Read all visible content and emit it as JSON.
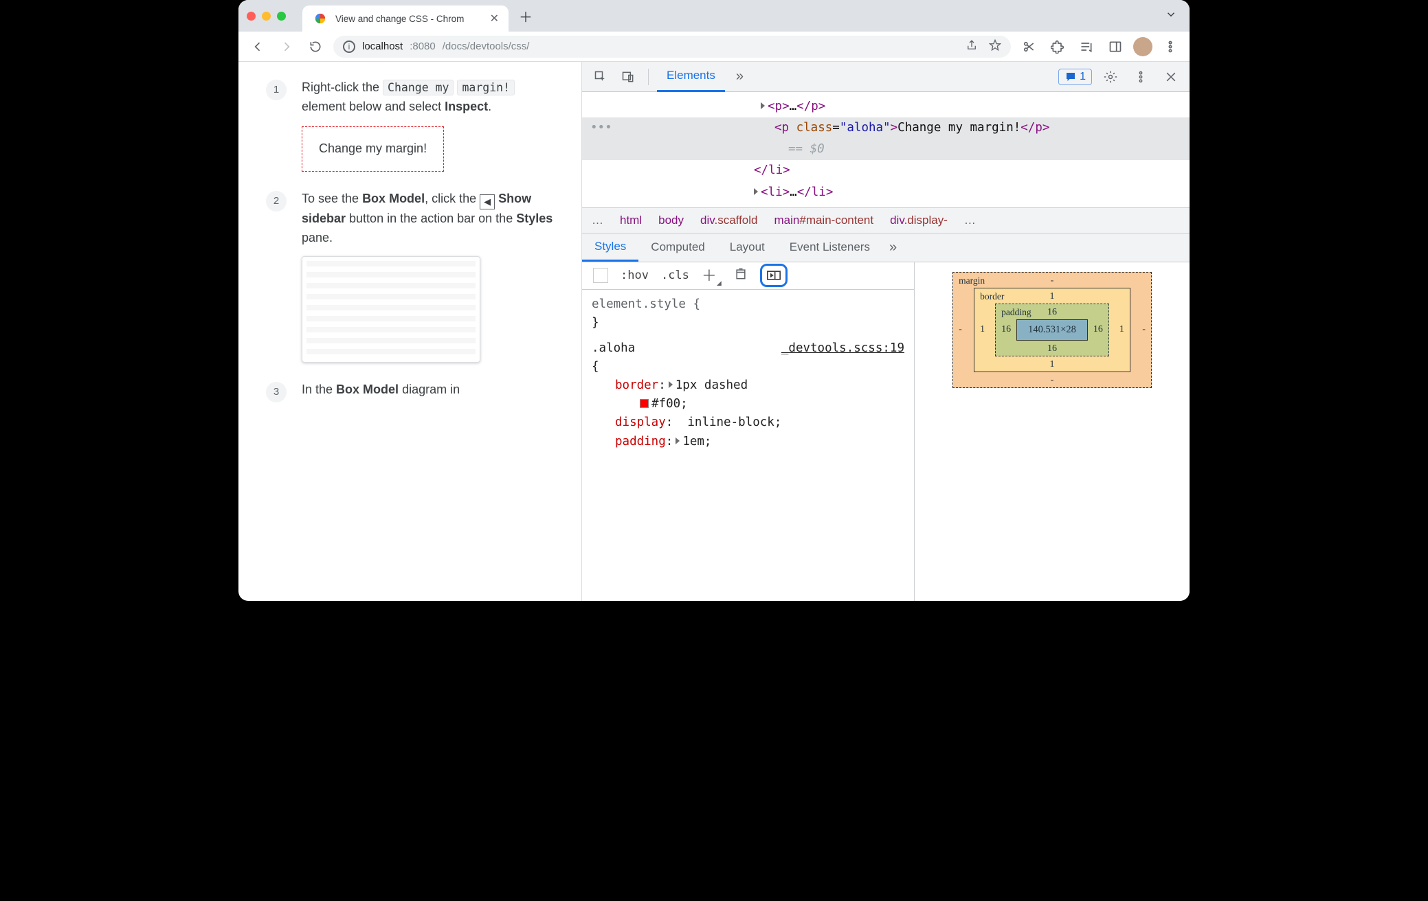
{
  "browser": {
    "tab_title": "View and change CSS - Chrom",
    "url_host": "localhost",
    "url_port": ":8080",
    "url_path": "/docs/devtools/css/"
  },
  "page": {
    "steps": [
      {
        "num": "1",
        "text_a": "Right-click the ",
        "chip_a": "Change my",
        "chip_b": "margin!",
        "text_b": " element below and select ",
        "bold_a": "Inspect",
        "text_c": ".",
        "demo": "Change my margin!"
      },
      {
        "num": "2",
        "text_a": "To see the ",
        "bold_a": "Box Model",
        "text_b": ", click the ",
        "bold_b": "Show sidebar",
        "text_c": " button in the action bar on the ",
        "bold_c": "Styles",
        "text_d": " pane."
      },
      {
        "num": "3",
        "text_a": "In the ",
        "bold_a": "Box Model",
        "text_b": " diagram in"
      }
    ]
  },
  "devtools": {
    "tabs": {
      "elements": "Elements"
    },
    "issues_count": "1",
    "dom": {
      "row1": "<p>…</p>",
      "row2_open": "<p class=\"aloha\">",
      "row2_text": "Change my margin!",
      "row2_close": "</p>",
      "row2_eq": "== $0",
      "row3": "</li>",
      "row4": "<li>…</li>"
    },
    "crumbs": [
      "…",
      "html",
      "body",
      "div",
      ".scaffold",
      "main",
      "#main-content",
      "div",
      ".display-"
    ],
    "styles_tabs": [
      "Styles",
      "Computed",
      "Layout",
      "Event Listeners"
    ],
    "actionbar": {
      "hov": ":hov",
      "cls": ".cls"
    },
    "css": {
      "element_style": "element.style {",
      "close": "}",
      "selector": ".aloha",
      "source": "_devtools.scss:19",
      "brace": "{",
      "rules": [
        {
          "prop": "border",
          "val_pre": "1px dashed",
          "val_color": "#f00",
          "has_tri": true,
          "has_swatch": true
        },
        {
          "prop": "display",
          "val_pre": "inline-block"
        },
        {
          "prop": "padding",
          "val_pre": "1em",
          "has_tri": true
        }
      ]
    },
    "boxmodel": {
      "margin_label": "margin",
      "border_label": "border",
      "padding_label": "padding",
      "content": "140.531×28",
      "margin": {
        "t": "-",
        "r": "-",
        "b": "-",
        "l": "-"
      },
      "border": {
        "t": "1",
        "r": "1",
        "b": "1",
        "l": "1"
      },
      "padding": {
        "t": "16",
        "r": "16",
        "b": "16",
        "l": "16"
      }
    }
  }
}
